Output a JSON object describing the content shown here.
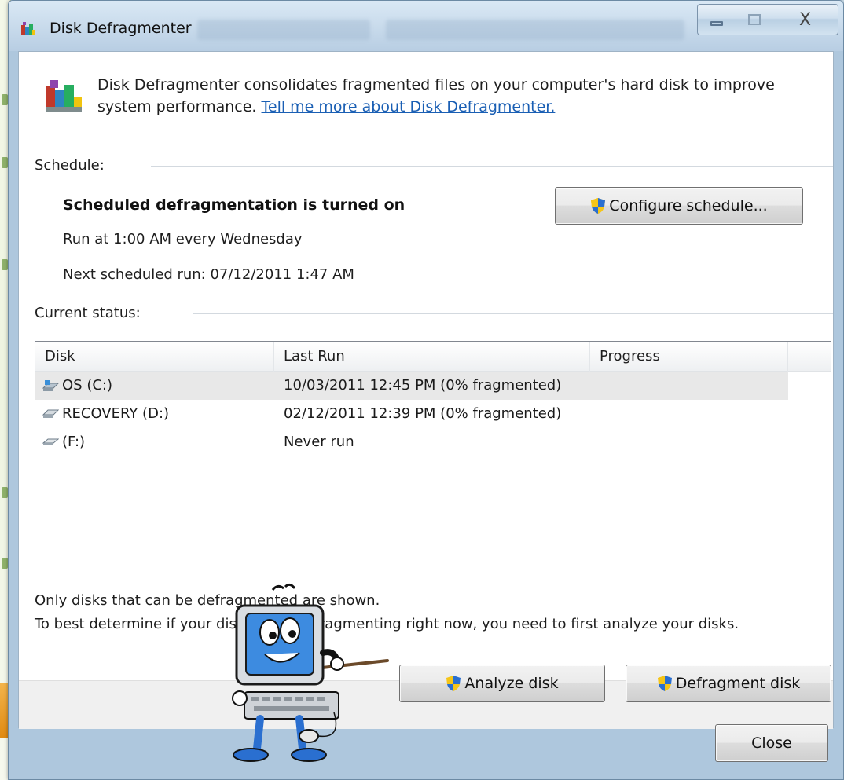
{
  "window": {
    "title": "Disk Defragmenter",
    "minimize_label": "Minimize",
    "maximize_label": "Maximize",
    "close_glyph": "X"
  },
  "intro": {
    "text": "Disk Defragmenter consolidates fragmented files on your computer's hard disk to improve system performance.",
    "link": "Tell me more about Disk Defragmenter."
  },
  "schedule": {
    "label": "Schedule:",
    "status": "Scheduled defragmentation is turned on",
    "run_at": "Run at 1:00 AM every Wednesday",
    "next_run": "Next scheduled run: 07/12/2011 1:47 AM",
    "configure_button": "Configure schedule..."
  },
  "current_status": {
    "label": "Current status:",
    "columns": [
      "Disk",
      "Last Run",
      "Progress"
    ],
    "rows": [
      {
        "disk": "OS (C:)",
        "last_run": "10/03/2011 12:45 PM (0% fragmented)",
        "progress": "",
        "icon": "os-drive-icon"
      },
      {
        "disk": "RECOVERY (D:)",
        "last_run": "02/12/2011 12:39 PM (0% fragmented)",
        "progress": "",
        "icon": "hard-drive-icon"
      },
      {
        "disk": "(F:)",
        "last_run": "Never run",
        "progress": "",
        "icon": "removable-drive-icon"
      }
    ]
  },
  "notes": {
    "line1": "Only disks that can be defragmented are shown.",
    "line2": "To best determine if your disks need defragmenting right now, you need to first analyze your disks."
  },
  "buttons": {
    "analyze": "Analyze disk",
    "defragment": "Defragment disk",
    "close": "Close"
  },
  "colors": {
    "link": "#1a5fb4",
    "selected_row": "#e8e8e8",
    "title_bar": "#b8cfe3"
  }
}
